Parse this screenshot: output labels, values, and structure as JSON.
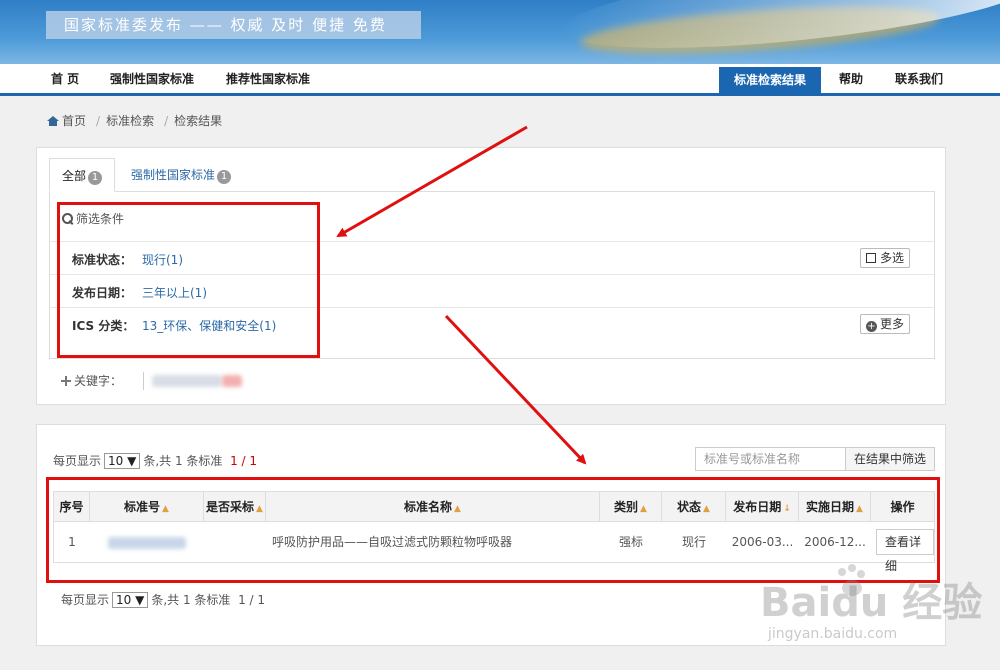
{
  "header": {
    "banner_text": "国家标准委发布 —— 权威 及时 便捷 免费"
  },
  "nav": {
    "items": [
      "首 页",
      "强制性国家标准",
      "推荐性国家标准"
    ],
    "active": "标准检索结果",
    "help": "帮助",
    "contact": "联系我们"
  },
  "breadcrumb": {
    "home": "首页",
    "search": "标准检索",
    "current": "检索结果"
  },
  "tabs": {
    "all": "全部",
    "all_count": "1",
    "mandatory": "强制性国家标准",
    "mandatory_count": "1"
  },
  "filters": {
    "title": "筛选条件",
    "rows": [
      {
        "label": "标准状态：",
        "value": "现行(1)",
        "button": "多选"
      },
      {
        "label": "发布日期：",
        "value": "三年以上(1)",
        "button": ""
      },
      {
        "label": "ICS 分类：",
        "value": "13_环保、保健和安全(1)",
        "button": "更多"
      }
    ],
    "keyword_label": "关键字："
  },
  "pager": {
    "prefix": "每页显示",
    "size": "10 ▼",
    "suffix": "条,共 1 条标准",
    "page": "1 / 1"
  },
  "search": {
    "placeholder": "标准号或标准名称",
    "button": "在结果中筛选"
  },
  "table": {
    "headers": [
      "序号",
      "标准号",
      "是否采标",
      "标准名称",
      "类别",
      "状态",
      "发布日期",
      "实施日期",
      "操作"
    ],
    "rows": [
      {
        "index": "1",
        "code": "",
        "adopted": "",
        "name": "呼吸防护用品——自吸过滤式防颗粒物呼吸器",
        "category": "强标",
        "status": "现行",
        "publish": "2006-03...",
        "implement": "2006-12...",
        "action": "查看详细"
      }
    ]
  },
  "watermark": {
    "brand": "Baidu 经验",
    "url": "jingyan.baidu.com"
  },
  "colors": {
    "primary": "#1a66b0",
    "link": "#2d6aa8",
    "annotation": "#e01010"
  }
}
